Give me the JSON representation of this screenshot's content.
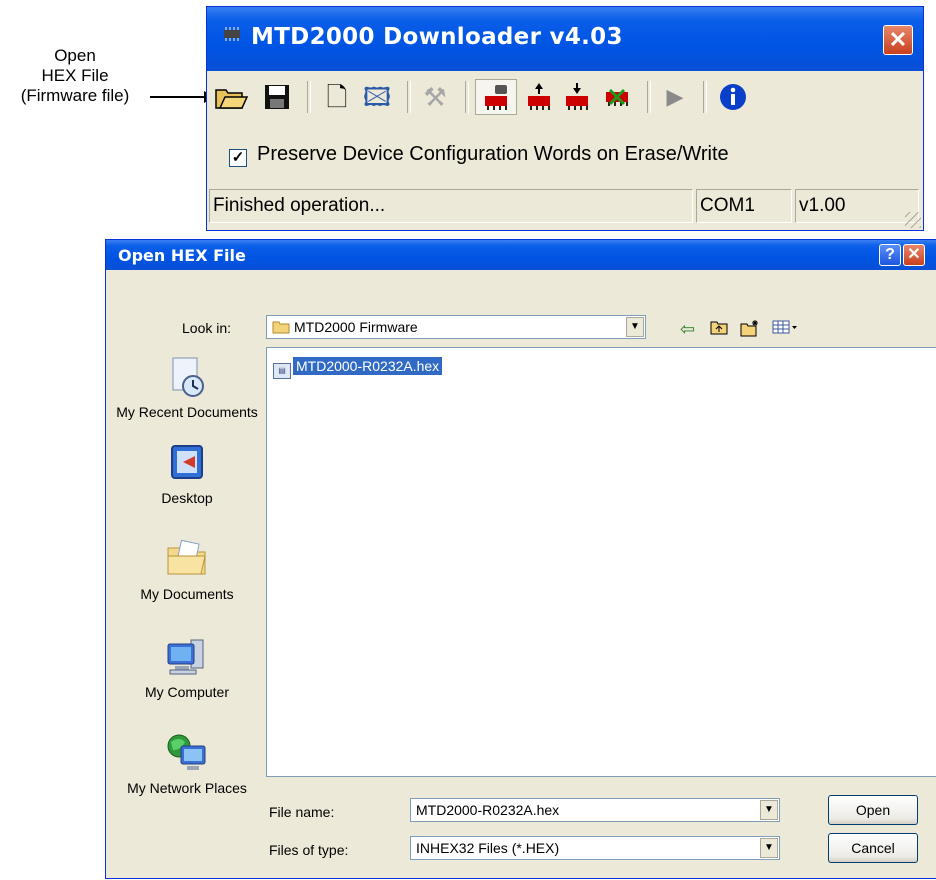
{
  "annotation": {
    "lines": [
      "Open",
      "HEX File",
      "(Firmware file)"
    ]
  },
  "downloader": {
    "title": "MTD2000 Downloader v4.03",
    "close_glyph": "✕",
    "toolbar": [
      {
        "name": "open-hex-icon",
        "glyph": "📂"
      },
      {
        "name": "save-icon",
        "glyph": "💾"
      },
      {
        "name": "new-document-icon",
        "glyph": "🗋"
      },
      {
        "name": "edit-buffer-icon",
        "glyph": "🖾"
      },
      {
        "name": "tools-icon",
        "glyph": "⚒"
      },
      {
        "name": "read-device-icon",
        "glyph": "▦"
      },
      {
        "name": "write-device-icon",
        "glyph": "⇧"
      },
      {
        "name": "verify-device-icon",
        "glyph": "⇩"
      },
      {
        "name": "erase-device-icon",
        "glyph": "✖"
      },
      {
        "name": "run-icon",
        "glyph": "▶"
      },
      {
        "name": "info-icon",
        "glyph": "ℹ"
      }
    ],
    "checkbox": {
      "label": "Preserve Device Configuration Words on Erase/Write",
      "checked": true,
      "mark": "✓"
    },
    "status": {
      "message": "Finished operation...",
      "port": "COM1",
      "version": "v1.00"
    }
  },
  "dialog": {
    "title": "Open HEX File",
    "help_glyph": "?",
    "close_glyph": "✕",
    "look_in_label": "Look in:",
    "look_in_value": "MTD2000 Firmware",
    "nav_icons": [
      "back-icon",
      "up-folder-icon",
      "new-folder-icon",
      "views-menu-icon"
    ],
    "places": [
      "My Recent Documents",
      "Desktop",
      "My Documents",
      "My Computer",
      "My Network Places"
    ],
    "files": [
      {
        "name": "MTD2000-R0232A.hex",
        "selected": true
      }
    ],
    "file_name_label": "File name:",
    "file_name_value": "MTD2000-R0232A.hex",
    "file_type_label": "Files of type:",
    "file_type_value": "INHEX32 Files (*.HEX)",
    "open_button": "Open",
    "cancel_button": "Cancel",
    "dropdown_glyph": "▼"
  }
}
